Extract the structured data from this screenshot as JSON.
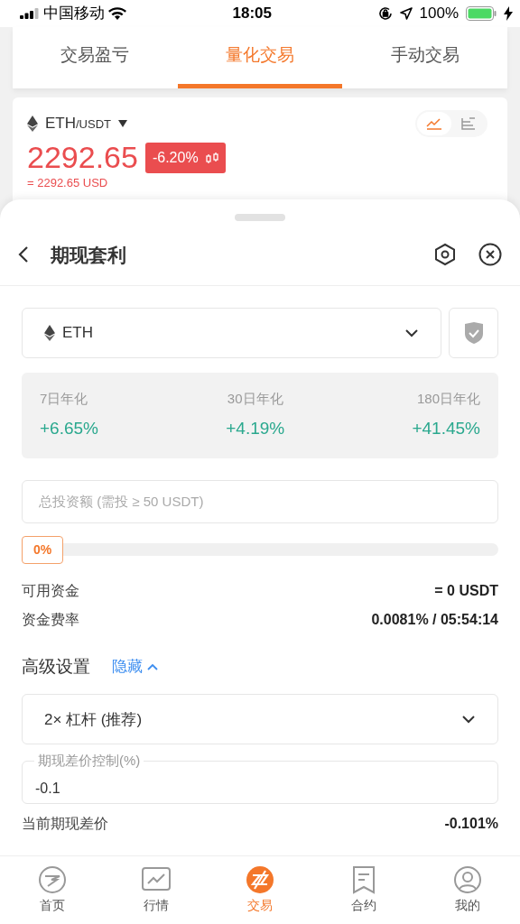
{
  "status_bar": {
    "carrier": "中国移动",
    "time": "18:05",
    "battery": "100%"
  },
  "tabs": [
    {
      "label": "交易盈亏",
      "selected": false
    },
    {
      "label": "量化交易",
      "selected": true
    },
    {
      "label": "手动交易",
      "selected": false
    }
  ],
  "ticker": {
    "base": "ETH",
    "quote": "/USDT",
    "price": "2292.65",
    "change": "-6.20%",
    "usd": "= 2292.65 USD",
    "view_toggle": [
      {
        "kind": "line",
        "selected": true
      },
      {
        "kind": "depth",
        "selected": false
      }
    ]
  },
  "sheet": {
    "title": "期现套利",
    "coin": "ETH",
    "stats": [
      {
        "label": "7日年化",
        "value": "+6.65%"
      },
      {
        "label": "30日年化",
        "value": "+4.19%"
      },
      {
        "label": "180日年化",
        "value": "+41.45%"
      }
    ],
    "amount": {
      "placeholder": "总投资额 (需投 ≥ 50 USDT)"
    },
    "slider": {
      "level": 0,
      "reading": "0%"
    },
    "info": [
      {
        "label": "可用资金",
        "value": "= 0 USDT"
      },
      {
        "label": "资金费率",
        "value": "0.0081% / 05:54:14"
      }
    ],
    "advanced": {
      "title": "高级设置",
      "toggle": "隐藏",
      "expanded": true
    },
    "leverage": "2× 杠杆 (推荐)",
    "spread_field": {
      "label": "期现差价控制(%)",
      "value": "-0.1"
    },
    "current": {
      "label": "当前期现差价",
      "value": "-0.101%"
    }
  },
  "nav": [
    {
      "kind": "home",
      "label": "首页",
      "selected": false
    },
    {
      "kind": "market",
      "label": "行情",
      "selected": false
    },
    {
      "kind": "trade",
      "label": "交易",
      "selected": true
    },
    {
      "kind": "contract",
      "label": "合约",
      "selected": false
    },
    {
      "kind": "profile",
      "label": "我的",
      "selected": false
    }
  ]
}
